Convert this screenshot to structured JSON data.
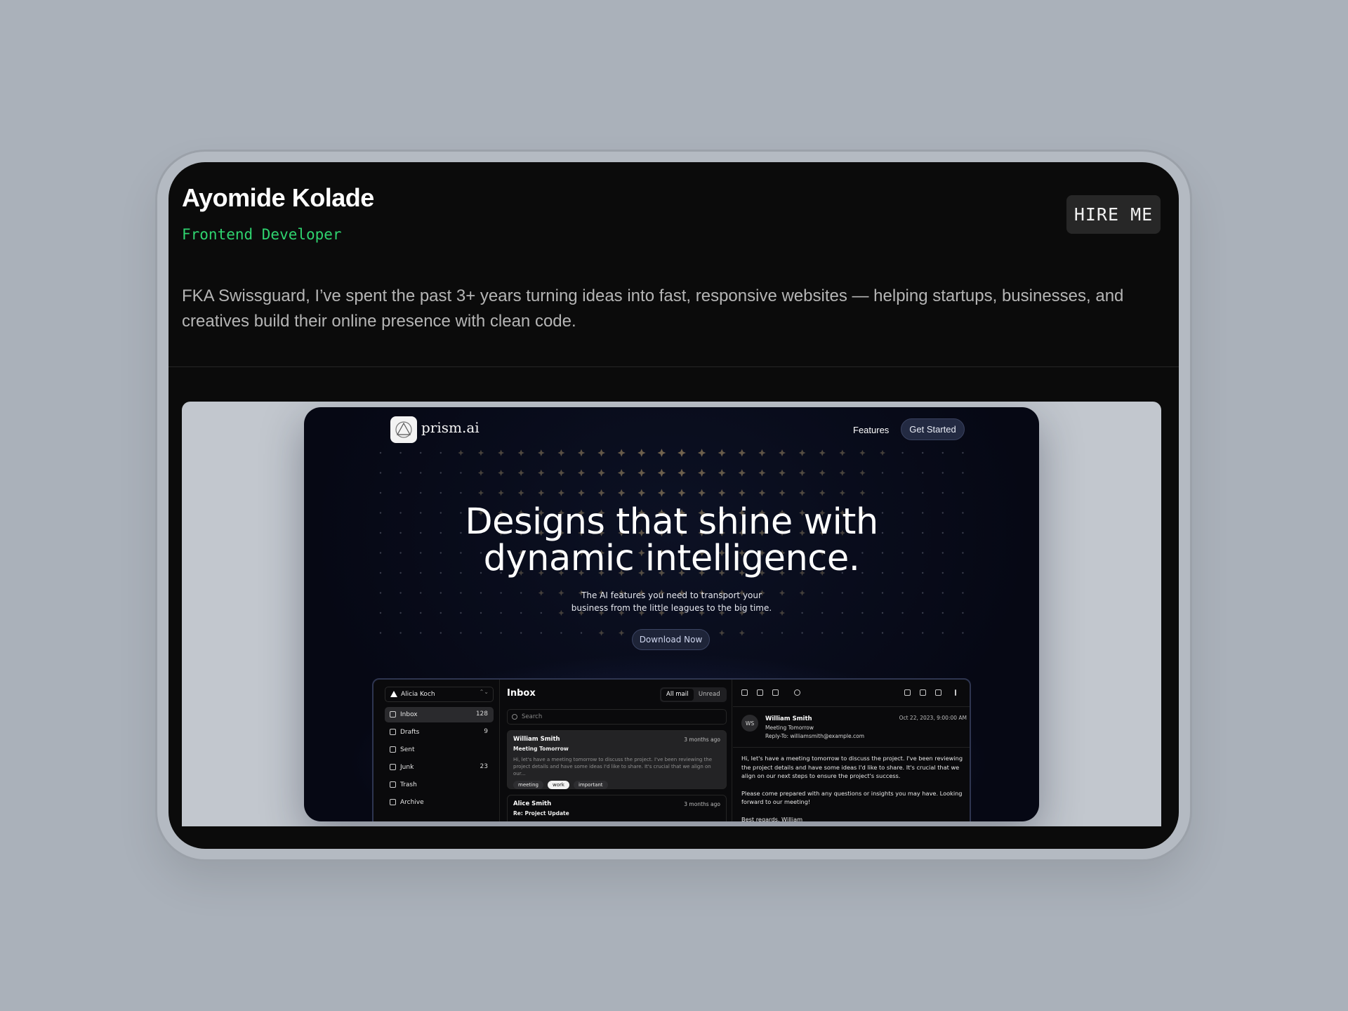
{
  "profile": {
    "name": "Ayomide Kolade",
    "role": "Frontend Developer",
    "hire_label": "HIRE ME",
    "bio": "FKA Swissguard, I’ve spent the past 3+ years turning ideas into fast, responsive websites — helping startups, businesses, and creatives build their online presence with clean code."
  },
  "preview": {
    "brand": "prism.ai",
    "nav": {
      "features": "Features",
      "cta": "Get Started"
    },
    "headline_1": "Designs that shine with",
    "headline_2": "dynamic intelligence.",
    "sub_1": "The AI features you need to transport your",
    "sub_2": "business from the little leagues to the big time.",
    "download": "Download Now",
    "accent_color": "#2fd36f",
    "app": {
      "account": "Alicia Koch",
      "nav": [
        {
          "label": "Inbox",
          "count": "128"
        },
        {
          "label": "Drafts",
          "count": "9"
        },
        {
          "label": "Sent",
          "count": ""
        },
        {
          "label": "Junk",
          "count": "23"
        },
        {
          "label": "Trash",
          "count": ""
        },
        {
          "label": "Archive",
          "count": ""
        }
      ],
      "title": "Inbox",
      "filters": [
        "All mail",
        "Unread"
      ],
      "search_placeholder": "Search",
      "mails": [
        {
          "from": "William Smith",
          "when": "3 months ago",
          "subject": "Meeting Tomorrow",
          "preview": "Hi, let's have a meeting tomorrow to discuss the project. I've been reviewing the project details and have some ideas I'd like to share. It's crucial that we align on our...",
          "tags": [
            "meeting",
            "work",
            "important"
          ]
        },
        {
          "from": "Alice Smith",
          "when": "3 months ago",
          "subject": "Re: Project Update"
        }
      ],
      "detail": {
        "avatar": "WS",
        "from": "William Smith",
        "subject": "Meeting Tomorrow",
        "reply_to": "Reply-To: williamsmith@example.com",
        "date": "Oct 22, 2023, 9:00:00 AM",
        "body_1": "Hi, let's have a meeting tomorrow to discuss the project. I've been reviewing the project details and have some ideas I'd like to share. It's crucial that we align on our next steps to ensure the project's success.",
        "body_2": "Please come prepared with any questions or insights you may have. Looking forward to our meeting!",
        "body_3": "Best regards, William"
      }
    }
  }
}
